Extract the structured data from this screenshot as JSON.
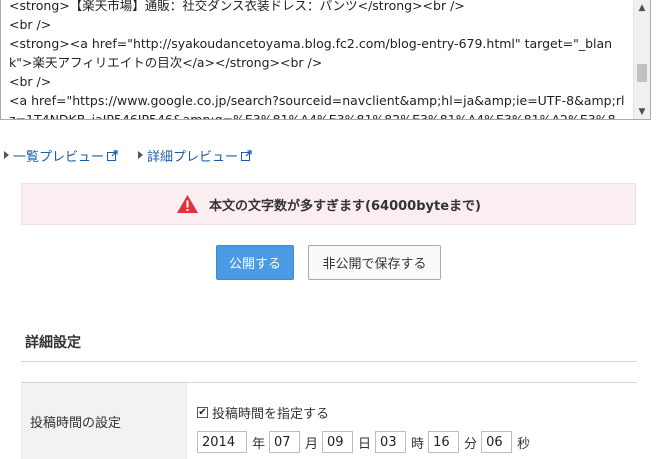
{
  "editor": {
    "text": "<strong>【楽天市場】通販：社交ダンス衣装ドレス：パンツ</strong><br />\n<br />\n<strong><a href=\"http://syakoudancetoyama.blog.fc2.com/blog-entry-679.html\" target=\"_blank\">楽天アフィリエイトの目次</a></strong><br />\n<br />\n<a href=\"https://www.google.co.jp/search?sourceid=navclient&amp;hl=ja&amp;ie=UTF-8&amp;rlz=1T4NDKB_jaJP546JP546&amp;q=%E3%81%A4%E3%81%82%E3%81%A4%E3%81%A2%E3%81%A2%E3%81%A0%E3%81%A3%E3%81%A2%E3%81%A0"
  },
  "preview": {
    "list_label": "一覧プレビュー",
    "detail_label": "詳細プレビュー"
  },
  "alert": {
    "message": "本文の文字数が多すぎます(64000byteまで)",
    "color": "#e0313e"
  },
  "buttons": {
    "publish": "公開する",
    "save_private": "非公開で保存する",
    "publish_color": "#4a9be3"
  },
  "detail_settings": {
    "title": "詳細設定",
    "post_time_label": "投稿時間の設定",
    "specify_time_label": "投稿時間を指定する",
    "specify_time_checked": true,
    "datetime": {
      "year": "2014",
      "year_unit": "年",
      "month": "07",
      "month_unit": "月",
      "day": "09",
      "day_unit": "日",
      "hour": "03",
      "hour_unit": "時",
      "minute": "16",
      "minute_unit": "分",
      "second": "06",
      "second_unit": "秒"
    }
  }
}
